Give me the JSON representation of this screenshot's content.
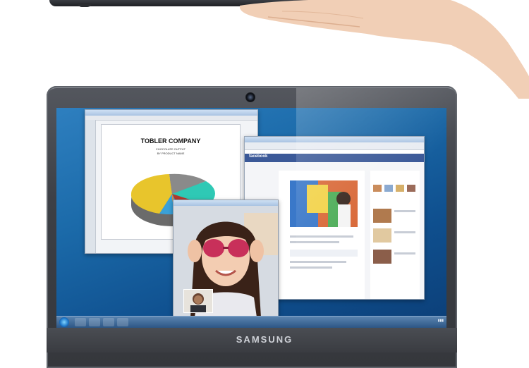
{
  "brand": {
    "label": "SAMSUNG"
  },
  "presentation": {
    "title": "TOBLER COMPANY",
    "subtitle_line1": "CHOCOLATE OUTPUT",
    "subtitle_line2": "BY PRODUCT NAME"
  },
  "browser": {
    "site_logo": "facebook"
  },
  "colors": {
    "desktop": "#1b6aa9",
    "facebook_bar": "#3b5998",
    "lid": "#3d4046"
  }
}
